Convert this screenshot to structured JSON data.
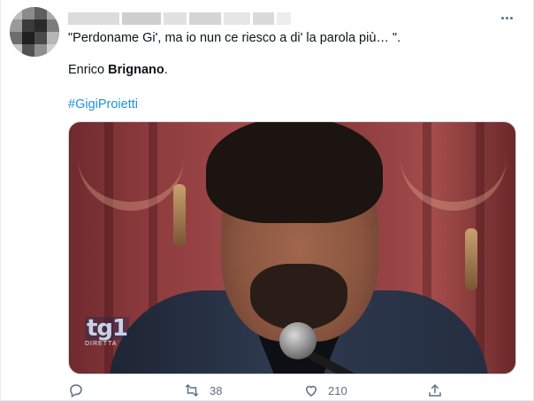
{
  "tweet": {
    "quote": "\"Perdoname Gi', ma io nun ce riesco a di' la parola più… \".",
    "author_first": "Enrico ",
    "author_last": "Brignano",
    "author_end": ".",
    "hashtag": "#GigiProietti"
  },
  "media": {
    "logo_text": "tg1",
    "logo_sub": "DIRETTA"
  },
  "actions": {
    "reply_icon": "reply-icon",
    "retweet_icon": "retweet-icon",
    "retweet_count": "38",
    "like_icon": "heart-icon",
    "like_count": "210",
    "share_icon": "share-icon"
  },
  "colors": {
    "link": "#1b95e0",
    "muted": "#5b7083"
  }
}
